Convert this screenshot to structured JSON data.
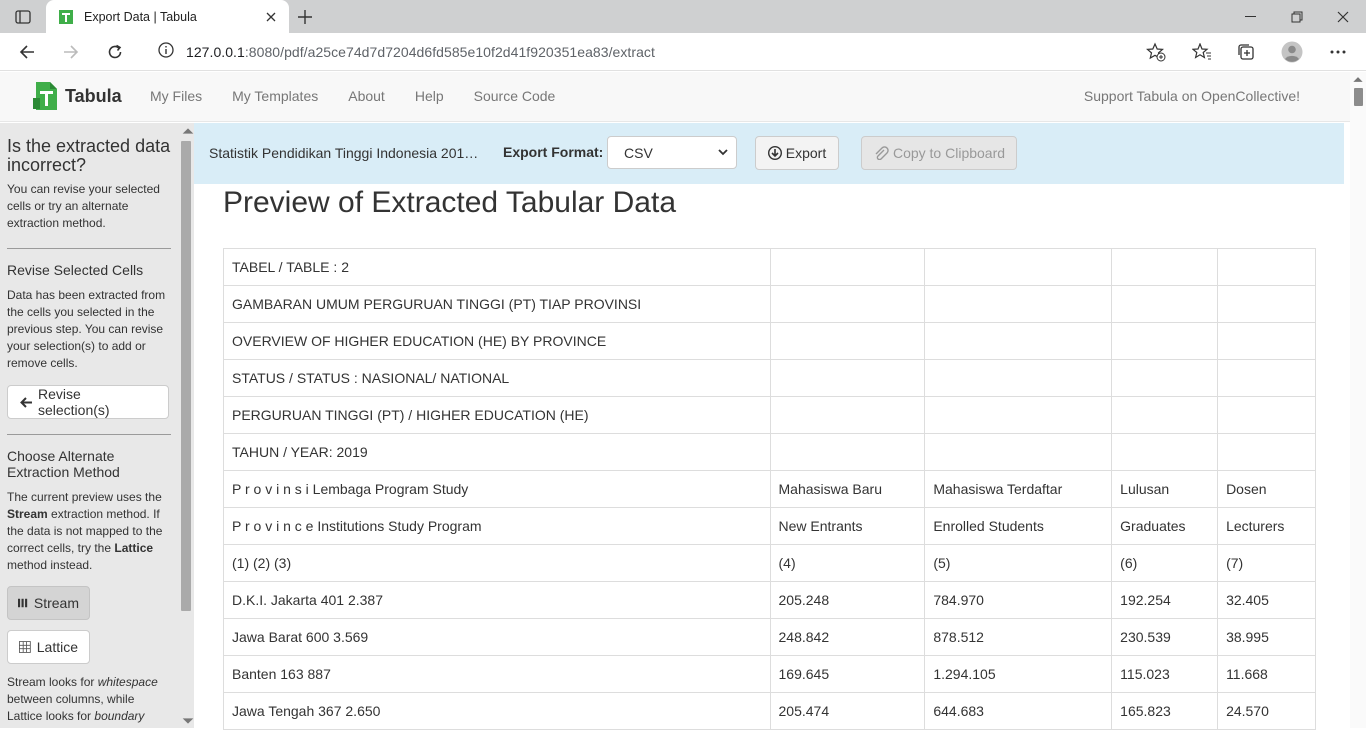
{
  "browser": {
    "tab_title": "Export Data | Tabula",
    "url_host": "127.0.0.1",
    "url_rest": ":8080/pdf/a25ce74d7d7204d6fd585e10f2d41f920351ea83/extract"
  },
  "app": {
    "brand": "Tabula",
    "nav": [
      "My Files",
      "My Templates",
      "About",
      "Help",
      "Source Code"
    ],
    "support": "Support Tabula on OpenCollective!"
  },
  "sidebar": {
    "heading": "Is the extracted data incorrect?",
    "intro": "You can revise your selected cells or try an alternate extraction method.",
    "revise_heading": "Revise Selected Cells",
    "revise_text": "Data has been extracted from the cells you selected in the previous step. You can revise your selection(s) to add or remove cells.",
    "revise_button": "Revise selection(s)",
    "alt_heading": "Choose Alternate Extraction Method",
    "alt_text_1": "The current preview uses the",
    "alt_text_stream": "Stream",
    "alt_text_2": "extraction method. If the data is not mapped to the correct cells, try the",
    "alt_text_lattice": "Lattice",
    "alt_text_3": "method instead.",
    "stream_button": "Stream",
    "lattice_button": "Lattice",
    "footer_1": "Stream looks for",
    "footer_ws": "whitespace",
    "footer_2": "between columns, while Lattice looks for",
    "footer_boundary": "boundary"
  },
  "toolbar": {
    "document_name": "Statistik Pendidikan Tinggi Indonesia 201…",
    "format_label": "Export Format:",
    "format_value": "CSV",
    "export_button": "Export",
    "copy_button": "Copy to Clipboard"
  },
  "preview": {
    "title": "Preview of Extracted Tabular Data",
    "rows": [
      [
        "TABEL / TABLE : 2",
        "",
        "",
        "",
        ""
      ],
      [
        "GAMBARAN UMUM PERGURUAN TINGGI (PT) TIAP PROVINSI",
        "",
        "",
        "",
        ""
      ],
      [
        "OVERVIEW OF HIGHER EDUCATION (HE) BY PROVINCE",
        "",
        "",
        "",
        ""
      ],
      [
        "STATUS / STATUS : NASIONAL/ NATIONAL",
        "",
        "",
        "",
        ""
      ],
      [
        "PERGURUAN TINGGI (PT) / HIGHER EDUCATION (HE)",
        "",
        "",
        "",
        ""
      ],
      [
        "TAHUN / YEAR: 2019",
        "",
        "",
        "",
        ""
      ],
      [
        "P r o v i n s i Lembaga Program Study",
        "Mahasiswa Baru",
        "Mahasiswa Terdaftar",
        "Lulusan",
        "Dosen"
      ],
      [
        "P r o v i n c e Institutions Study Program",
        "New Entrants",
        "Enrolled Students",
        "Graduates",
        "Lecturers"
      ],
      [
        "(1) (2) (3)",
        "(4)",
        "(5)",
        "(6)",
        "(7)"
      ],
      [
        "D.K.I. Jakarta 401 2.387",
        "205.248",
        "784.970",
        "192.254",
        "32.405"
      ],
      [
        "Jawa Barat 600 3.569",
        "248.842",
        "878.512",
        "230.539",
        "38.995"
      ],
      [
        "Banten 163 887",
        "169.645",
        "1.294.105",
        "115.023",
        "11.668"
      ],
      [
        "Jawa Tengah 367 2.650",
        "205.474",
        "644.683",
        "165.823",
        "24.570"
      ]
    ]
  }
}
